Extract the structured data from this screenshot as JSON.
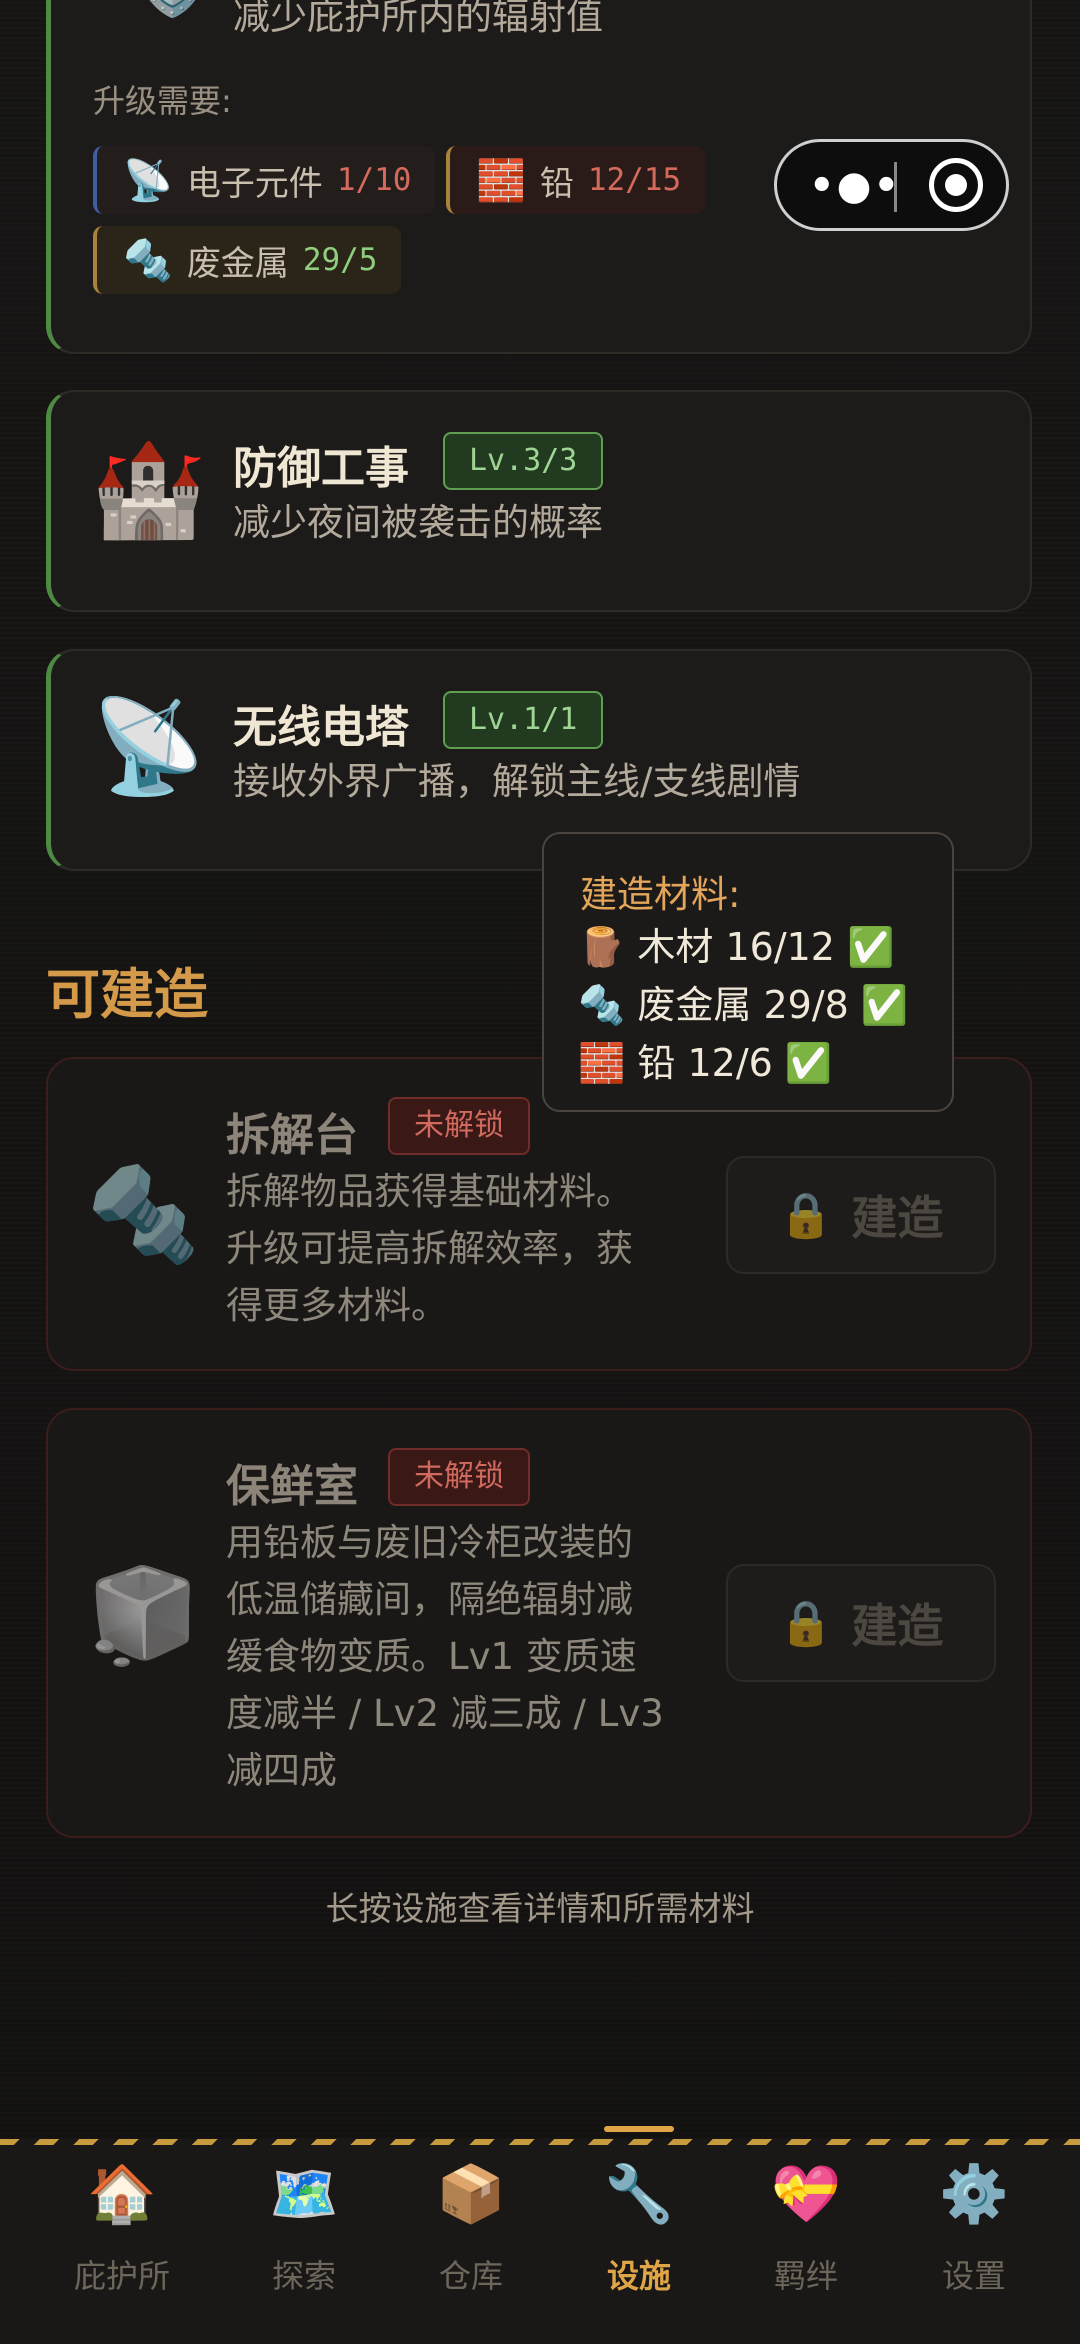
{
  "top_card": {
    "icon": "🛡️",
    "desc_partial": "减少庇护所内的辐射值",
    "requirements_label": "升级需要:",
    "requirements": [
      {
        "icon": "📡",
        "name": "电子元件",
        "count": "1/10",
        "met": false,
        "accent": "#3d5fa0"
      },
      {
        "icon": "🧱",
        "name": "铅",
        "count": "12/15",
        "met": false,
        "accent": "#a8833c"
      },
      {
        "icon": "🔩",
        "name": "废金属",
        "count": "29/5",
        "met": true,
        "accent": "#a8833c"
      }
    ]
  },
  "built_facilities": [
    {
      "icon": "🏰",
      "name": "防御工事",
      "level": "Lv.3/3",
      "desc": "减少夜间被袭击的概率"
    },
    {
      "icon": "📡",
      "name": "无线电塔",
      "level": "Lv.1/1",
      "desc": "接收外界广播，解锁主线/支线剧情"
    }
  ],
  "section_title": "可建造",
  "buildable": [
    {
      "icon": "🔩",
      "name": "拆解台",
      "status": "未解锁",
      "desc_lines": [
        "拆解物品获得基础材料。",
        "升级可提高拆解效率，获",
        "得更多材料。"
      ],
      "button": "建造",
      "button_icon": "🔒"
    },
    {
      "icon": "🧊",
      "name": "保鲜室",
      "status": "未解锁",
      "desc_lines": [
        "用铅板与废旧冷柜改装的",
        "低温储藏间，隔绝辐射减",
        "缓食物变质。Lv1 变质速",
        "度减半 / Lv2 减三成 / Lv3",
        "减四成"
      ],
      "button": "建造",
      "button_icon": "🔒"
    }
  ],
  "tooltip": {
    "title": "建造材料:",
    "lines": [
      "🪵 木材 16/12 ✅",
      "🔩 废金属 29/8 ✅",
      "🧱 铅 12/6 ✅"
    ]
  },
  "hint": "长按设施查看详情和所需材料",
  "mini_program_capsule": {
    "more_icon": "more-dots-icon",
    "close_icon": "target-icon"
  },
  "tabs": [
    {
      "icon": "🏠",
      "label": "庇护所",
      "active": false
    },
    {
      "icon": "🗺️",
      "label": "探索",
      "active": false
    },
    {
      "icon": "📦",
      "label": "仓库",
      "active": false
    },
    {
      "icon": "🔧",
      "label": "设施",
      "active": true
    },
    {
      "icon": "💝",
      "label": "羁绊",
      "active": false
    },
    {
      "icon": "⚙️",
      "label": "设置",
      "active": false
    }
  ],
  "colors": {
    "accent": "#e0a546",
    "built_border": "#4e8a43",
    "locked_border": "#6f2c28",
    "met_count": "#8fce7c",
    "unmet_count": "#d46a5c"
  }
}
